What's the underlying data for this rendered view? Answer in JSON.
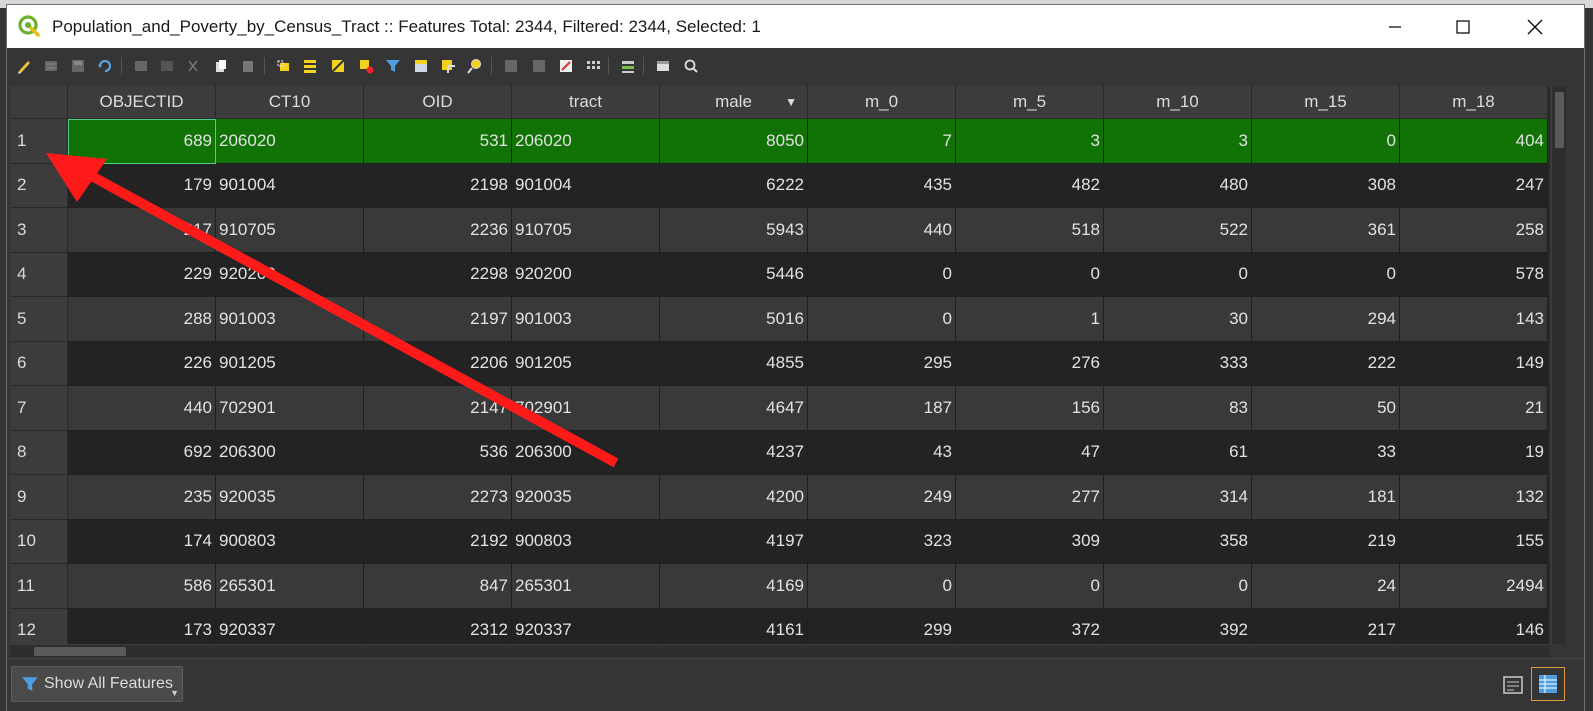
{
  "window": {
    "title": "Population_and_Poverty_by_Census_Tract :: Features Total: 2344, Filtered: 2344, Selected: 1",
    "min_icon": "minimize-icon",
    "max_icon": "maximize-icon",
    "close_icon": "close-icon"
  },
  "toolbar": {
    "icons": [
      "toggle-editing-icon",
      "multi-edit-icon",
      "save-edits-icon",
      "reload-icon",
      "add-feature-icon",
      "delete-feature-icon",
      "cut-icon",
      "copy-icon",
      "paste-icon",
      "select-by-expression-icon",
      "select-all-icon",
      "invert-selection-icon",
      "deselect-all-icon",
      "filter-icon",
      "move-selection-top-icon",
      "pan-to-selection-icon",
      "zoom-to-selection-icon",
      "new-field-icon",
      "delete-field-icon",
      "field-calculator-icon",
      "conditional-formatting-icon",
      "actions-icon",
      "dock-icon",
      "search-icon"
    ]
  },
  "table": {
    "columns": [
      "OBJECTID",
      "CT10",
      "OID",
      "tract",
      "male",
      "m_0",
      "m_5",
      "m_10",
      "m_15",
      "m_18"
    ],
    "sorted_column": "male",
    "sort_indicator": "▼",
    "rows": [
      {
        "num": "1",
        "cells": [
          "689",
          "206020",
          "531",
          "206020",
          "8050",
          "7",
          "3",
          "3",
          "0",
          "404"
        ]
      },
      {
        "num": "2",
        "cells": [
          "179",
          "901004",
          "2198",
          "901004",
          "6222",
          "435",
          "482",
          "480",
          "308",
          "247"
        ]
      },
      {
        "num": "3",
        "cells": [
          "217",
          "910705",
          "2236",
          "910705",
          "5943",
          "440",
          "518",
          "522",
          "361",
          "258"
        ]
      },
      {
        "num": "4",
        "cells": [
          "229",
          "920200",
          "2298",
          "920200",
          "5446",
          "0",
          "0",
          "0",
          "0",
          "578"
        ]
      },
      {
        "num": "5",
        "cells": [
          "288",
          "901003",
          "2197",
          "901003",
          "5016",
          "0",
          "1",
          "30",
          "294",
          "143"
        ]
      },
      {
        "num": "6",
        "cells": [
          "226",
          "901205",
          "2206",
          "901205",
          "4855",
          "295",
          "276",
          "333",
          "222",
          "149"
        ]
      },
      {
        "num": "7",
        "cells": [
          "440",
          "702901",
          "2147",
          "702901",
          "4647",
          "187",
          "156",
          "83",
          "50",
          "21"
        ]
      },
      {
        "num": "8",
        "cells": [
          "692",
          "206300",
          "536",
          "206300",
          "4237",
          "43",
          "47",
          "61",
          "33",
          "19"
        ]
      },
      {
        "num": "9",
        "cells": [
          "235",
          "920035",
          "2273",
          "920035",
          "4200",
          "249",
          "277",
          "314",
          "181",
          "132"
        ]
      },
      {
        "num": "10",
        "cells": [
          "174",
          "900803",
          "2192",
          "900803",
          "4197",
          "323",
          "309",
          "358",
          "219",
          "155"
        ]
      },
      {
        "num": "11",
        "cells": [
          "586",
          "265301",
          "847",
          "265301",
          "4169",
          "0",
          "0",
          "0",
          "24",
          "2494"
        ]
      },
      {
        "num": "12",
        "cells": [
          "173",
          "920337",
          "2312",
          "920337",
          "4161",
          "299",
          "372",
          "392",
          "217",
          "146"
        ]
      }
    ],
    "selected_row": 0
  },
  "bottom": {
    "filter_button_label": "Show All Features",
    "form_view_icon": "form-view-icon",
    "table_view_icon": "table-view-icon"
  },
  "colors": {
    "selection": "#117306",
    "annotation_arrow": "#ff1a1a",
    "window_bg": "#353535"
  }
}
